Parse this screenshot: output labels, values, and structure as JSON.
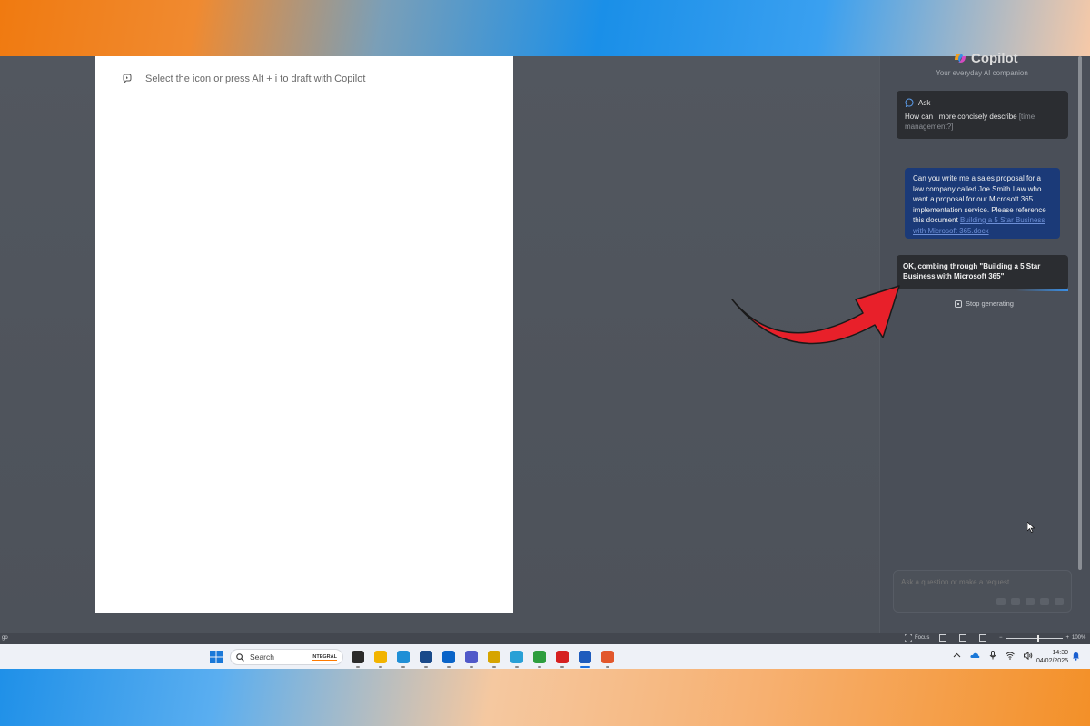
{
  "document": {
    "draft_hint": "Select the icon or press Alt + i to draft with Copilot"
  },
  "copilot": {
    "title": "Copilot",
    "subtitle": "Your everyday AI companion",
    "ask": {
      "label": "Ask",
      "prompt_prefix": "How can I more concisely describe ",
      "prompt_placeholder": "[time management?]"
    },
    "user_message": {
      "text": "Can you write me a sales proposal for a law company called Joe Smith Law who want a proposal for our Microsoft 365 implementation service. Please reference this document ",
      "doc_link": "Building a 5 Star Business with Microsoft 365.docx"
    },
    "bot_message": "OK, combing through \"Building a 5 Star Business with Microsoft 365\"",
    "stop_label": "Stop generating",
    "composer_placeholder": "Ask a question or make a request"
  },
  "status_bar": {
    "left_text": "go",
    "focus_label": "Focus",
    "zoom_value": "100%",
    "zoom_level_percent": 100
  },
  "taskbar": {
    "search_label": "Search",
    "search_badge": "INTEGRAL",
    "time": "14:30",
    "date": "04/02/2025",
    "apps": [
      {
        "icon": "task-view-icon",
        "color": "#2b2b2b",
        "active": false
      },
      {
        "icon": "file-explorer-icon",
        "color": "#f2b400",
        "active": false
      },
      {
        "icon": "edge-icon",
        "color": "#1f8fd6",
        "active": false
      },
      {
        "icon": "store-icon",
        "color": "#1a4a8a",
        "active": false
      },
      {
        "icon": "outlook-icon",
        "color": "#0a64c8",
        "active": false
      },
      {
        "icon": "teams-icon",
        "color": "#5059c9",
        "active": false
      },
      {
        "icon": "app-gear-icon",
        "color": "#d6a400",
        "active": false
      },
      {
        "icon": "app-cube-icon",
        "color": "#29a0d6",
        "active": false
      },
      {
        "icon": "camtasia-icon",
        "color": "#2e9e3e",
        "active": false
      },
      {
        "icon": "acrobat-icon",
        "color": "#d62020",
        "active": false
      },
      {
        "icon": "word-icon",
        "color": "#1e5bbd",
        "active": true
      },
      {
        "icon": "camtasia-recorder-icon",
        "color": "#e2572c",
        "active": false
      }
    ]
  },
  "colors": {
    "accent_arrow": "#e8202a",
    "user_bubble": "#1b3a78",
    "bot_bubble": "#2b2d31"
  }
}
